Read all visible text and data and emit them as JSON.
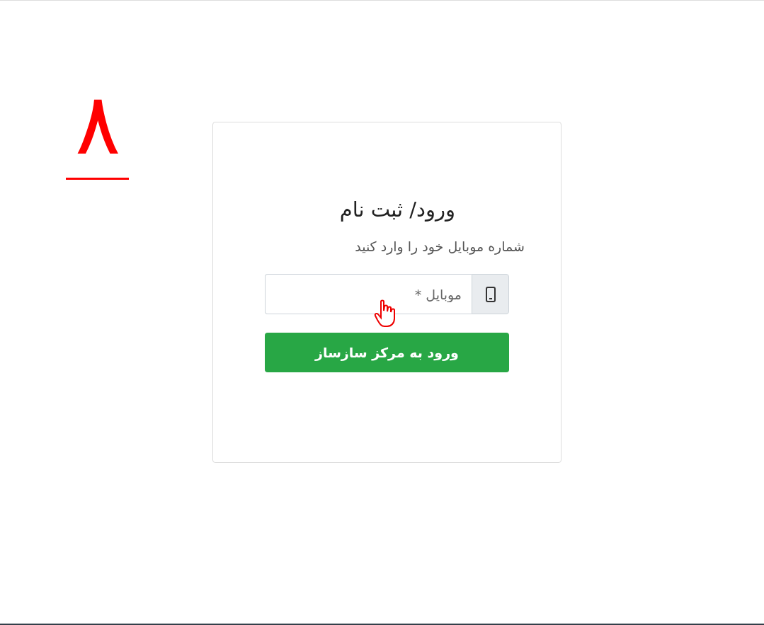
{
  "step_number": "۸",
  "login_card": {
    "title": "ورود/ ثبت نام",
    "subtitle": "شماره موبایل خود را وارد کنید",
    "mobile_field": {
      "placeholder": "موبایل *"
    },
    "submit_button": "ورود به مرکز سازساز"
  }
}
